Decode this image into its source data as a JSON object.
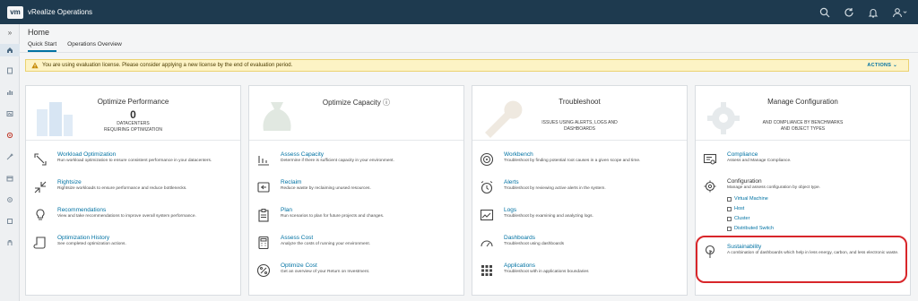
{
  "app": {
    "logo": "vm",
    "title": "vRealize Operations"
  },
  "topbar_icons": [
    "search-icon",
    "refresh-icon",
    "bell-icon",
    "user-icon"
  ],
  "rail": {
    "toggle": "»"
  },
  "header": {
    "title": "Home",
    "tabs": [
      {
        "label": "Quick Start"
      },
      {
        "label": "Operations Overview"
      }
    ]
  },
  "banner": {
    "text": "You are using evaluation license. Please consider applying a new license by the end of evaluation period.",
    "actions_label": "ACTIONS ⌄"
  },
  "cards": [
    {
      "title": "Optimize Performance",
      "count": "0",
      "sub": "DATACENTERS\nREQUIRING OPTIMIZATION",
      "items": [
        {
          "title": "Workload Optimization",
          "desc": "Run workload optimization to ensure consistent performance in your datacenters."
        },
        {
          "title": "Rightsize",
          "desc": "Rightsize workloads to ensure performance and reduce bottlenecks."
        },
        {
          "title": "Recommendations",
          "desc": "View and take recommendations to improve overall system performance."
        },
        {
          "title": "Optimization History",
          "desc": "See completed optimization actions."
        }
      ]
    },
    {
      "title": "Optimize Capacity ⓘ",
      "items": [
        {
          "title": "Assess Capacity",
          "desc": "Determine if there is sufficient capacity in your environment."
        },
        {
          "title": "Reclaim",
          "desc": "Reduce waste by reclaiming unused resources."
        },
        {
          "title": "Plan",
          "desc": "Run scenarios to plan for future projects and changes."
        },
        {
          "title": "Assess Cost",
          "desc": "Analyze the costs of running your environment."
        },
        {
          "title": "Optimize Cost",
          "desc": "Get an overview of your Return on Investment."
        }
      ]
    },
    {
      "title": "Troubleshoot",
      "sub": "ISSUES USING ALERTS, LOGS AND\nDASHBOARDS",
      "items": [
        {
          "title": "Workbench",
          "desc": "Troubleshoot by finding potential root causes in a given scope and time."
        },
        {
          "title": "Alerts",
          "desc": "Troubleshoot by reviewing active alerts in the system."
        },
        {
          "title": "Logs",
          "desc": "Troubleshoot by examining and analyzing logs."
        },
        {
          "title": "Dashboards",
          "desc": "Troubleshoot using dashboards"
        },
        {
          "title": "Applications",
          "desc": "Troubleshoot with in applications boundaries"
        }
      ]
    },
    {
      "title": "Manage Configuration",
      "sub": "AND COMPLIANCE BY BENCHMARKS\nAND OBJECT TYPES",
      "items": [
        {
          "title": "Compliance",
          "desc": "Assess and Manage Compliance."
        },
        {
          "title": "Configuration",
          "desc": "Manage and assess configuration by object type."
        },
        {
          "title": "Sustainability",
          "desc": "A combination of dashboards which help in less energy, carbon, and less electronic waste."
        }
      ],
      "config_links": [
        "Virtual Machine",
        "Host",
        "Cluster",
        "Distributed Switch"
      ]
    }
  ],
  "colors": {
    "topbar": "#1e3a4f",
    "link": "#0072a3",
    "banner": "#fdf3c5",
    "highlight": "#d8262a"
  }
}
